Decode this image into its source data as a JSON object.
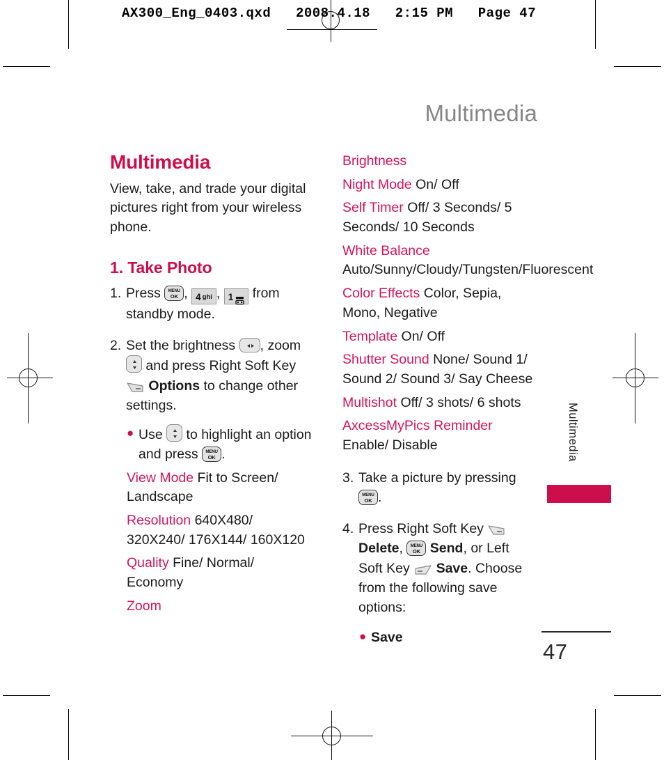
{
  "slug": "AX300_Eng_0403.qxd   2008.4.18   2:15 PM   Page 47",
  "running_head": "Multimedia",
  "side_tab": {
    "label": "Multimedia",
    "color": "#cd0e4c"
  },
  "folio": {
    "page_number": "47"
  },
  "theme": {
    "accent": "#cd0e4c",
    "term_color": "#d4145a",
    "body_color": "#1b1b1b",
    "running_head_color": "#868686"
  },
  "left_column": {
    "section_title": "Multimedia",
    "intro": "View, take, and trade your digital pictures right from your wireless phone.",
    "subsection_title": "1. Take Photo",
    "step1": {
      "number": "1.",
      "text_before": "Press",
      "comma1": ",",
      "comma2": ",",
      "text_after": "from",
      "text_line2": "standby mode.",
      "icons": [
        "menu-ok-key",
        "key-4-ghi",
        "key-1-voicemail"
      ]
    },
    "step2": {
      "number": "2.",
      "part1": "Set the brightness",
      "part2": ", zoom",
      "part3": "and press Right Soft Key",
      "part4_bold": "Options",
      "part5": "to change other",
      "part6": "settings.",
      "icons": [
        "left-right-nav-key",
        "up-down-nav-key",
        "right-soft-key"
      ]
    },
    "bullet1": {
      "text_before": "Use",
      "text_mid": "to highlight an",
      "text_after": "option and press",
      "period": ".",
      "icons": [
        "up-down-nav-key",
        "menu-ok-key"
      ]
    },
    "settings": [
      {
        "term": "View Mode",
        "value": "Fit to Screen/ Landscape"
      },
      {
        "term": "Resolution",
        "value": "640X480/ 320X240/ 176X144/ 160X120"
      },
      {
        "term": "Quality",
        "value": "Fine/ Normal/ Economy"
      },
      {
        "term": "Zoom",
        "value": ""
      }
    ]
  },
  "right_column": {
    "settings": [
      {
        "term": "Brightness",
        "value": ""
      },
      {
        "term": "Night Mode",
        "value": "On/ Off"
      },
      {
        "term": "Self Timer",
        "value": "Off/ 3 Seconds/ 5 Seconds/ 10 Seconds"
      },
      {
        "term": "White Balance",
        "value": "Auto/Sunny/Cloudy/Tungsten/Fluorescent"
      },
      {
        "term": "Color Effects",
        "value": "Color, Sepia, Mono, Negative"
      },
      {
        "term": "Template",
        "value": "On/ Off"
      },
      {
        "term": "Shutter Sound",
        "value": "None/ Sound 1/ Sound 2/ Sound 3/ Say Cheese"
      },
      {
        "term": "Multishot",
        "value": "Off/ 3 shots/ 6 shots"
      },
      {
        "term": "AxcessMyPics Reminder",
        "value": "Enable/ Disable"
      }
    ],
    "step3": {
      "number": "3.",
      "text": "Take a picture by pressing",
      "period": ".",
      "icons": [
        "menu-ok-key"
      ]
    },
    "step4": {
      "number": "4.",
      "part1": "Press Right Soft Key",
      "part2_bold": "Delete",
      "comma1": ",",
      "part3_bold": "Send",
      "comma2": ",",
      "part4": "or Left Soft Key",
      "part5_bold": "Save",
      "period": ".",
      "part6": "Choose from the following save options:",
      "icons": [
        "right-soft-key",
        "menu-ok-key",
        "left-soft-key"
      ]
    },
    "bullet_save": {
      "label": "Save"
    }
  }
}
